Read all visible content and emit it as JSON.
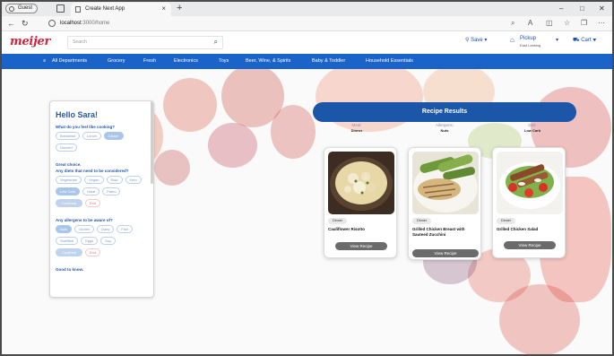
{
  "browser": {
    "guest_label": "Guest",
    "tab_title": "Create Next App",
    "url_host": "localhost",
    "url_path": ":3000/home",
    "window_controls": [
      "–",
      "□",
      "✕"
    ]
  },
  "site": {
    "logo": "meijer",
    "search_placeholder": "Search",
    "store": "Save",
    "pickup": "Pickup",
    "pickup_sub": "East Lansing",
    "cart": "Cart"
  },
  "categories": [
    "All Departments",
    "Grocery",
    "Fresh",
    "Electronics",
    "Toys",
    "Beer, Wine, & Spirits",
    "Baby & Toddler",
    "Household Essentials"
  ],
  "chat": {
    "greeting": "Hello Sara!",
    "q1": "What do you feel like cooking?",
    "meals": [
      "Breakfast",
      "Lunch",
      "Dinner",
      "Dessert"
    ],
    "meals_selected": "Dinner",
    "ack": "Great choice.",
    "q2": "Any diets that need to be considered?",
    "diets": [
      "Vegetarian",
      "Vegan",
      "Raw",
      "Keto",
      "Low Carb",
      "Halal",
      "Paleo"
    ],
    "diets_selected": "Low Carb",
    "continue_label": "Continue",
    "end_label": "End",
    "q3": "Any allergens to be aware of?",
    "allergens": [
      "Nuts",
      "Gluten",
      "Dairy",
      "Fish",
      "Shellfish",
      "Eggs",
      "Soy"
    ],
    "allergens_selected": "Nuts",
    "good_to_know": "Good to know."
  },
  "results": {
    "header": "Recipe Results",
    "filters": [
      {
        "label": "Meal:",
        "value": "Dinner"
      },
      {
        "label": "Allergens:",
        "value": "Nuts"
      },
      {
        "label": "Diet:",
        "value": "Low Carb"
      }
    ],
    "cards": [
      {
        "badge": "Dinner",
        "title": "Cauliflower Risotto",
        "button": "View Recipe"
      },
      {
        "badge": "Dinner",
        "title": "Grilled Chicken Breast with Sauteed Zucchini",
        "button": "View Recipe"
      },
      {
        "badge": "Dinner",
        "title": "Grilled Chicken Salad",
        "button": "View Recipe"
      }
    ]
  },
  "colors": {
    "brand_red": "#d6213a",
    "nav_blue": "#1a64c9",
    "results_blue": "#1b56a8",
    "chip_selected": "#a9c5ea"
  }
}
